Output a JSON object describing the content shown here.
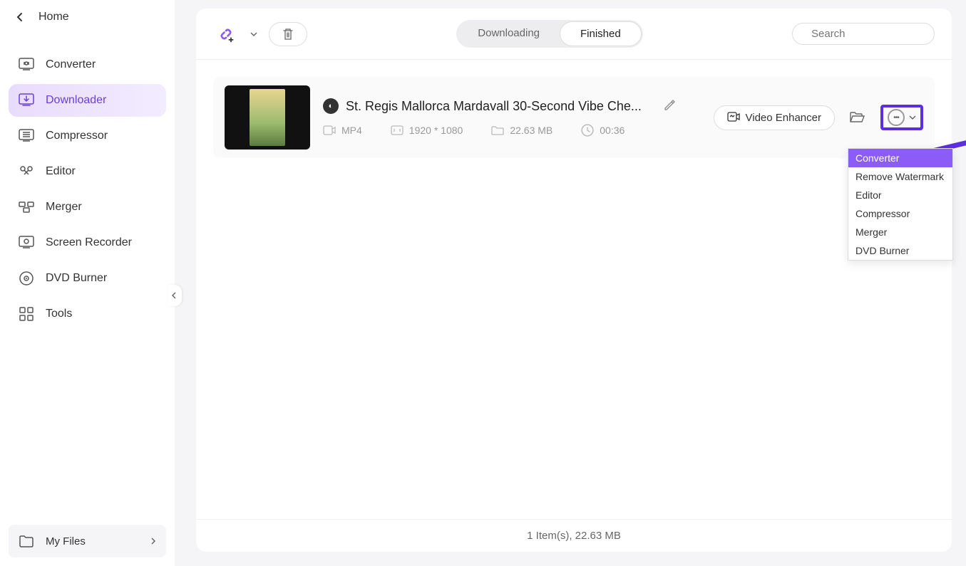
{
  "header": {
    "home": "Home"
  },
  "sidebar": {
    "items": [
      {
        "label": "Converter"
      },
      {
        "label": "Downloader"
      },
      {
        "label": "Compressor"
      },
      {
        "label": "Editor"
      },
      {
        "label": "Merger"
      },
      {
        "label": "Screen Recorder"
      },
      {
        "label": "DVD Burner"
      },
      {
        "label": "Tools"
      }
    ],
    "my_files": "My Files"
  },
  "tabs": {
    "downloading": "Downloading",
    "finished": "Finished"
  },
  "search": {
    "placeholder": "Search"
  },
  "file": {
    "title": "St. Regis Mallorca Mardavall  30-Second Vibe Che...",
    "format": "MP4",
    "resolution": "1920 * 1080",
    "size": "22.63 MB",
    "duration": "00:36",
    "enhancer": "Video Enhancer"
  },
  "menu": {
    "items": [
      "Converter",
      "Remove Watermark",
      "Editor",
      "Compressor",
      "Merger",
      "DVD Burner"
    ]
  },
  "status": "1 Item(s), 22.63 MB",
  "colors": {
    "accent": "#5b2ee0"
  }
}
